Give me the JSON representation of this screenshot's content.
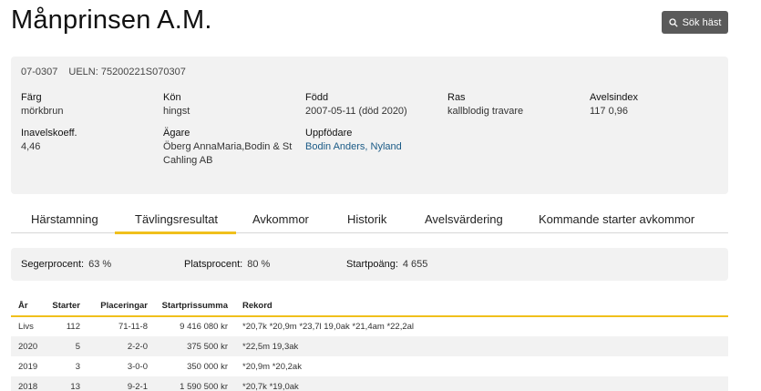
{
  "header": {
    "title": "Månprinsen A.M.",
    "search_label": "Sök häst"
  },
  "info": {
    "reg_no": "07-0307",
    "ueln": "UELN: 75200221S070307",
    "fields": {
      "farg": {
        "label": "Färg",
        "value": "mörkbrun"
      },
      "kon": {
        "label": "Kön",
        "value": "hingst"
      },
      "fodd": {
        "label": "Född",
        "value": "2007-05-11 (död 2020)"
      },
      "ras": {
        "label": "Ras",
        "value": "kallblodig travare"
      },
      "avelsindex": {
        "label": "Avelsindex",
        "value": "117 0,96"
      },
      "inavel": {
        "label": "Inavelskoeff.",
        "value": "4,46"
      },
      "agare": {
        "label": "Ägare",
        "value_line1": "Öberg AnnaMaria,Bodin & St",
        "value_line2": "Cahling AB"
      },
      "uppfodare": {
        "label": "Uppfödare",
        "value": "Bodin Anders, Nyland"
      }
    }
  },
  "tabs": [
    {
      "label": "Härstamning"
    },
    {
      "label": "Tävlingsresultat"
    },
    {
      "label": "Avkommor"
    },
    {
      "label": "Historik"
    },
    {
      "label": "Avelsvärdering"
    },
    {
      "label": "Kommande starter avkommor"
    }
  ],
  "stats": {
    "seger": {
      "label": "Segerprocent:",
      "value": "63 %"
    },
    "plats": {
      "label": "Platsprocent:",
      "value": "80 %"
    },
    "start": {
      "label": "Startpoäng:",
      "value": "4 655"
    }
  },
  "results": {
    "headers": [
      "År",
      "Starter",
      "Placeringar",
      "Startprissumma",
      "Rekord"
    ],
    "rows": [
      [
        "Livs",
        "112",
        "71-11-8",
        "9 416 080 kr",
        "*20,7k *20,9m *23,7l 19,0ak *21,4am *22,2al"
      ],
      [
        "2020",
        "5",
        "2-2-0",
        "375 500 kr",
        "*22,5m 19,3ak"
      ],
      [
        "2019",
        "3",
        "3-0-0",
        "350 000 kr",
        "*20,9m *20,2ak"
      ],
      [
        "2018",
        "13",
        "9-2-1",
        "1 590 500 kr",
        "*20,7k *19,0ak"
      ]
    ]
  },
  "colors": {
    "accent": "#f0c01c",
    "link": "#1a5a86",
    "button": "#5a5a5a",
    "panel": "#f2f2f2"
  }
}
